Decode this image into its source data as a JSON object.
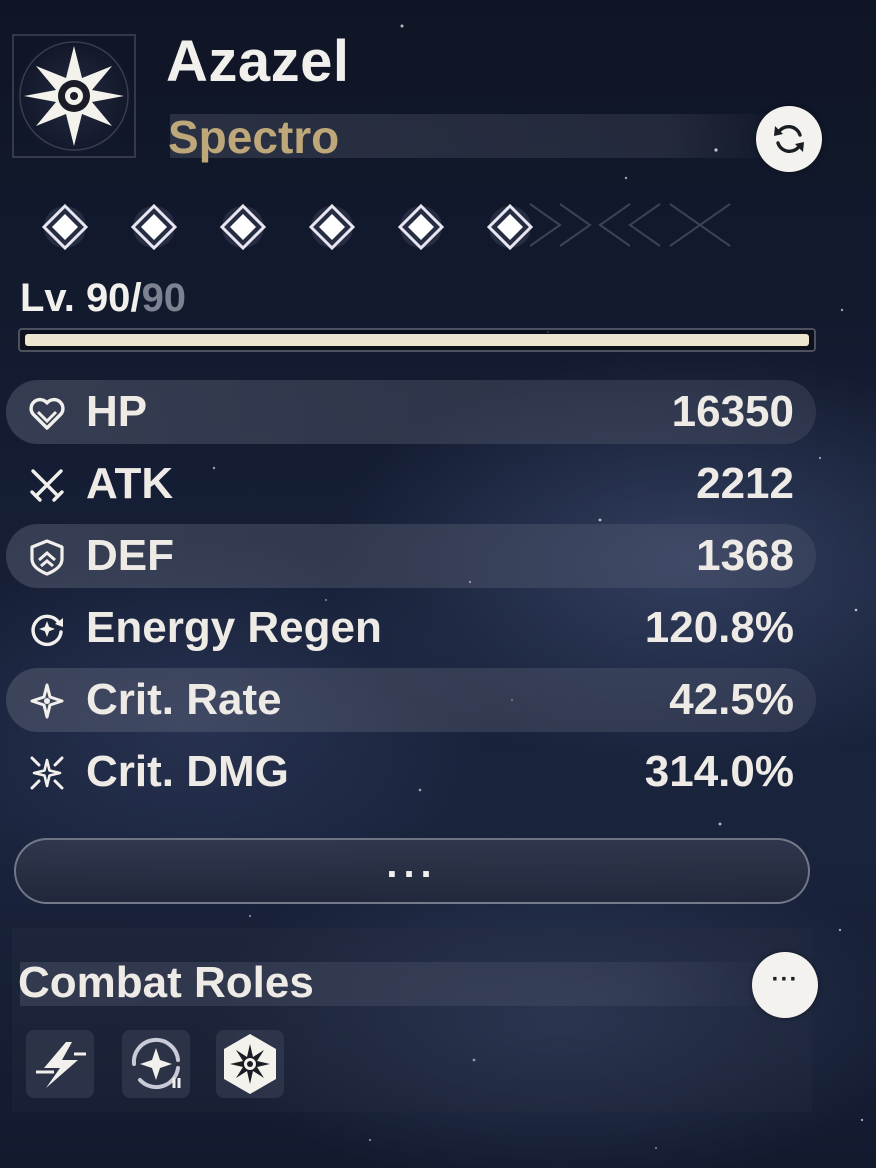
{
  "character": {
    "name": "Azazel",
    "attribute": "Spectro"
  },
  "sequence": {
    "unlocked": 6,
    "total": 6
  },
  "level": {
    "prefix": "Lv. ",
    "current": "90",
    "separator": "/",
    "max": "90",
    "progress": 1.0
  },
  "stats": [
    {
      "label": "HP",
      "value": "16350",
      "icon": "hp-heart-icon"
    },
    {
      "label": "ATK",
      "value": "2212",
      "icon": "atk-swords-icon"
    },
    {
      "label": "DEF",
      "value": "1368",
      "icon": "def-shield-icon"
    },
    {
      "label": "Energy Regen",
      "value": "120.8%",
      "icon": "energy-regen-icon"
    },
    {
      "label": "Crit. Rate",
      "value": "42.5%",
      "icon": "crit-rate-star-icon"
    },
    {
      "label": "Crit. DMG",
      "value": "314.0%",
      "icon": "crit-dmg-stars-icon"
    }
  ],
  "more_button": {
    "label": "..."
  },
  "combat_roles": {
    "title": "Combat Roles",
    "more_label": "···",
    "roles": [
      {
        "icon": "burst-role-icon"
      },
      {
        "icon": "support-role-icon"
      },
      {
        "icon": "spectro-role-icon"
      }
    ]
  },
  "colors": {
    "attribute": "#bea87a",
    "text": "#eeebe6",
    "max_level": "#7d8290",
    "level_fill": "#ece6cf"
  }
}
